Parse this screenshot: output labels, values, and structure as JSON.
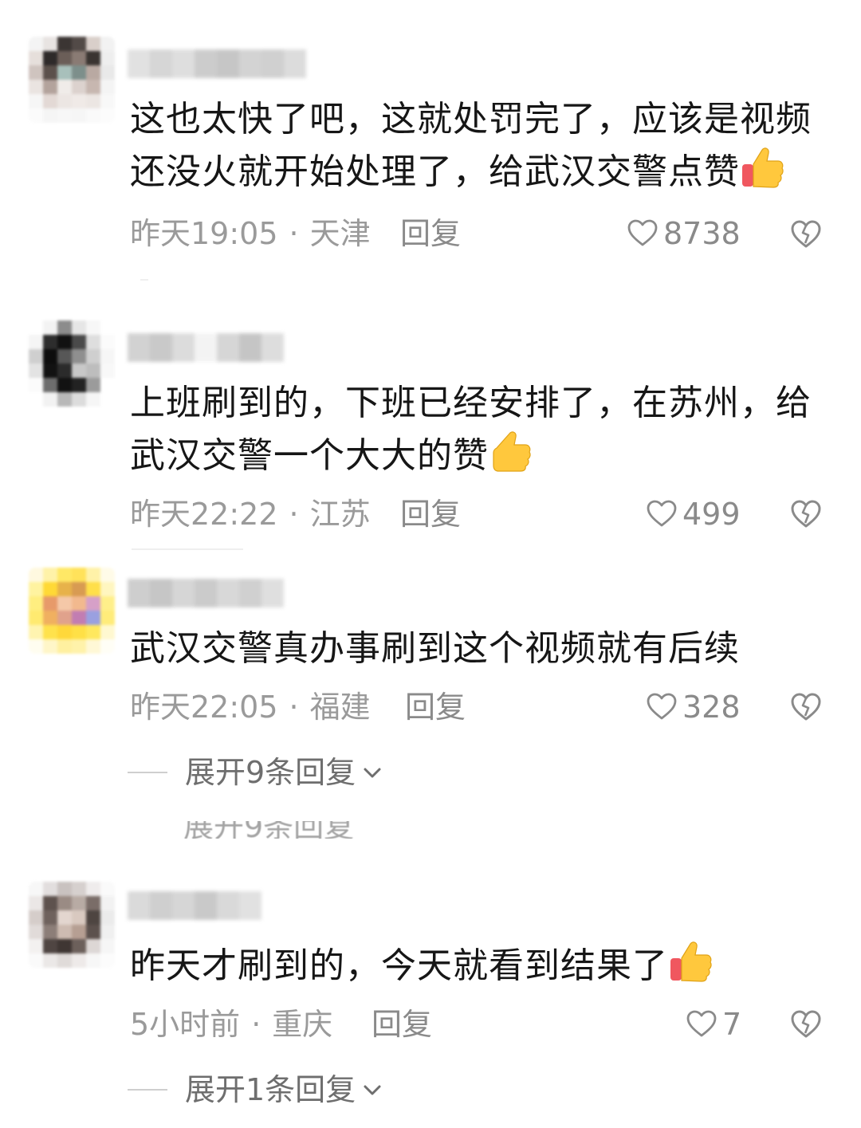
{
  "comments": [
    {
      "text": "这也太快了吧，这就处罚完了，应该是视频还没火就开始处理了，给武汉交警点赞",
      "emoji": "thumbs-up-icon",
      "time": "昨天19:05",
      "location": "天津",
      "reply_label": "回复",
      "likes": "8738"
    },
    {
      "text": "上班刷到的，下班已经安排了，在苏州，给武汉交警一个大大的赞",
      "emoji": "thumbs-up-icon",
      "time": "昨天22:22",
      "location": "江苏",
      "reply_label": "回复",
      "likes": "499"
    },
    {
      "text": "武汉交警真办事刷到这个视频就有后续",
      "time": "昨天22:05",
      "location": "福建",
      "reply_label": "回复",
      "likes": "328",
      "expand_label": "展开9条回复"
    },
    {
      "text": "昨天才刷到的，今天就看到结果了",
      "emoji": "thumbs-up-icon",
      "time": "5小时前",
      "location": "重庆",
      "reply_label": "回复",
      "likes": "7",
      "expand_label": "展开1条回复"
    }
  ],
  "meta_separator": "·",
  "colors": {
    "text": "#161616",
    "meta": "#9a9a9a",
    "action": "#8a8a8a",
    "expand": "#6e6e6e",
    "thumb_yellow": "#FFC83D",
    "thumb_cuff": "#F0575F"
  }
}
